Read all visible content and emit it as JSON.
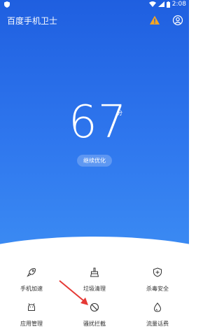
{
  "status_bar": {
    "time": "2:08"
  },
  "app_bar": {
    "title": "百度手机卫士"
  },
  "score": {
    "value": "67",
    "unit": "分",
    "action_label": "继续优化"
  },
  "tools": [
    {
      "label": "手机加速",
      "icon": "rocket-icon"
    },
    {
      "label": "垃圾清理",
      "icon": "broom-icon"
    },
    {
      "label": "杀毒安全",
      "icon": "shield-icon"
    },
    {
      "label": "应用管理",
      "icon": "android-icon"
    },
    {
      "label": "骚扰拦截",
      "icon": "block-icon"
    },
    {
      "label": "流量话费",
      "icon": "drop-icon"
    }
  ],
  "colors": {
    "hero_top": "#1f5fe0",
    "hero_bottom": "#3c8cf3",
    "warning": "#f5a623",
    "annotation_arrow": "#e53935"
  }
}
